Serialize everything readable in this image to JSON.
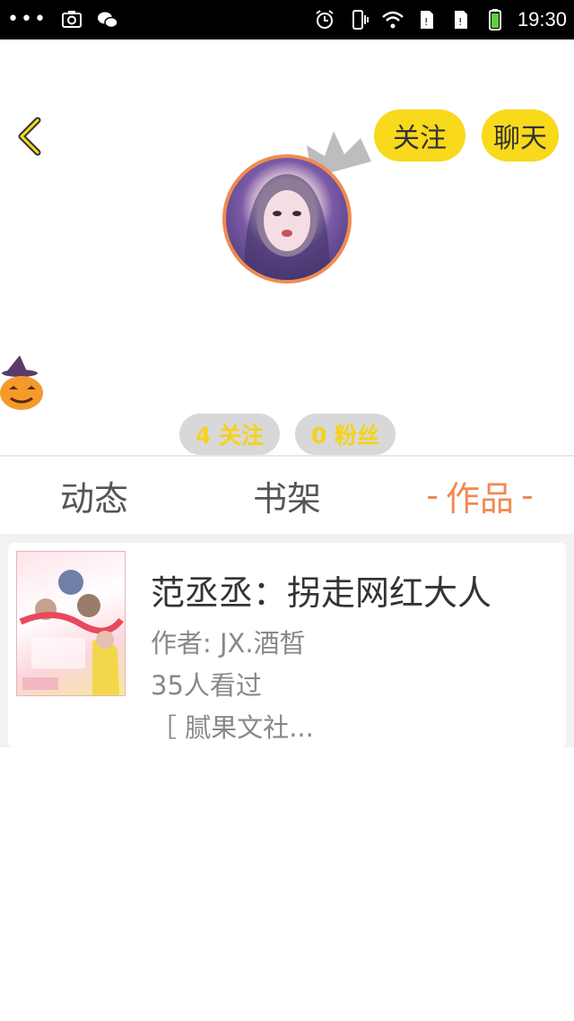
{
  "status_bar": {
    "left_icons": [
      "more-dots-icon",
      "screenshot-icon",
      "wechat-icon"
    ],
    "right_icons": [
      "alarm-icon",
      "vibrate-icon",
      "wifi-icon",
      "sim1-icon",
      "sim2-icon",
      "battery-icon"
    ],
    "time": "19:30"
  },
  "header": {
    "back_icon": "chevron-left-icon",
    "follow_label": "关注",
    "chat_label": "聊天",
    "accent_color": "#f8d91b"
  },
  "profile": {
    "avatar_border_color": "#f08a52",
    "following_count": "4 关注",
    "fans_count": "0 粉丝"
  },
  "tabs": [
    {
      "label": "动态",
      "active": false
    },
    {
      "label": "书架",
      "active": false
    },
    {
      "label": "作品",
      "active": true,
      "dash": "-"
    }
  ],
  "works": [
    {
      "title": "范丞丞：拐走网红大人",
      "author": "作者: JX.酒晳",
      "views": "35人看过",
      "tags": "［ 腻果文社..."
    }
  ],
  "colors": {
    "active_tab": "#f08a52",
    "stat_text": "#f5d21a"
  }
}
